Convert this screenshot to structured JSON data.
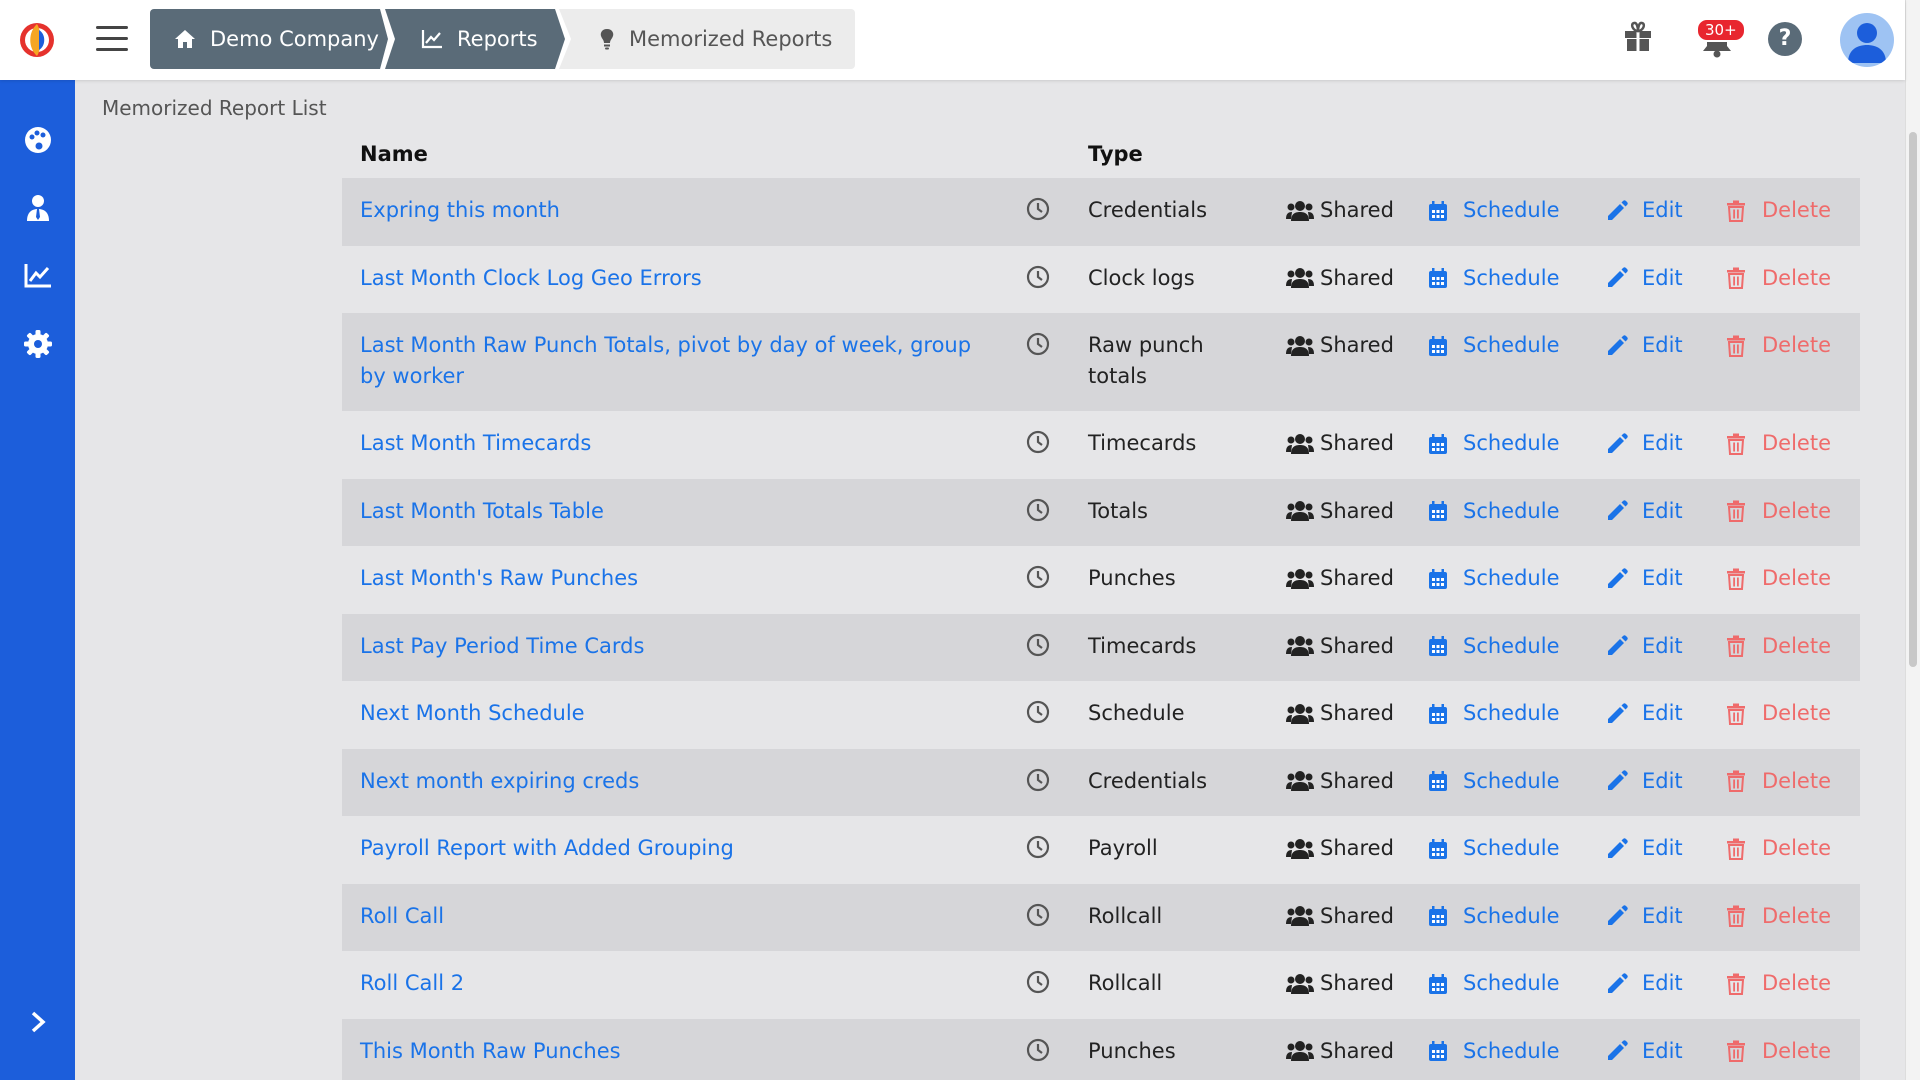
{
  "breadcrumb": [
    {
      "label": "Demo Company",
      "icon": "home-icon"
    },
    {
      "label": "Reports",
      "icon": "chart-line-icon"
    },
    {
      "label": "Memorized Reports",
      "icon": "lightbulb-icon"
    }
  ],
  "header": {
    "notification_count": "30+",
    "help_label": "?"
  },
  "sidebar": {
    "items": [
      {
        "name": "dashboard",
        "icon": "palette-icon"
      },
      {
        "name": "workers",
        "icon": "user-tie-icon"
      },
      {
        "name": "reports",
        "icon": "chart-line-icon"
      },
      {
        "name": "settings",
        "icon": "gear-icon"
      }
    ],
    "expand_icon": "chevron-right-icon"
  },
  "colors": {
    "sidebar": "#1c5edb",
    "breadcrumb": "#5a6b78",
    "link": "#1a73e8",
    "delete": "#ef6b6b",
    "badge": "#e8262f"
  },
  "main": {
    "title": "Memorized Report List",
    "columns": {
      "name": "Name",
      "type": "Type"
    },
    "labels": {
      "shared": "Shared",
      "schedule": "Schedule",
      "edit": "Edit",
      "delete": "Delete"
    },
    "rows": [
      {
        "name": "Expring this month",
        "type": "Credentials"
      },
      {
        "name": "Last Month Clock Log Geo Errors",
        "type": "Clock logs"
      },
      {
        "name": "Last Month Raw Punch Totals, pivot by day of week, group by worker",
        "type": "Raw punch totals"
      },
      {
        "name": "Last Month Timecards",
        "type": "Timecards"
      },
      {
        "name": "Last Month Totals Table",
        "type": "Totals"
      },
      {
        "name": "Last Month's Raw Punches",
        "type": "Punches"
      },
      {
        "name": "Last Pay Period Time Cards",
        "type": "Timecards"
      },
      {
        "name": "Next Month Schedule",
        "type": "Schedule"
      },
      {
        "name": "Next month expiring creds",
        "type": "Credentials"
      },
      {
        "name": "Payroll Report with Added Grouping",
        "type": "Payroll"
      },
      {
        "name": "Roll Call",
        "type": "Rollcall"
      },
      {
        "name": "Roll Call 2",
        "type": "Rollcall"
      },
      {
        "name": "This Month Raw Punches",
        "type": "Punches"
      }
    ]
  }
}
